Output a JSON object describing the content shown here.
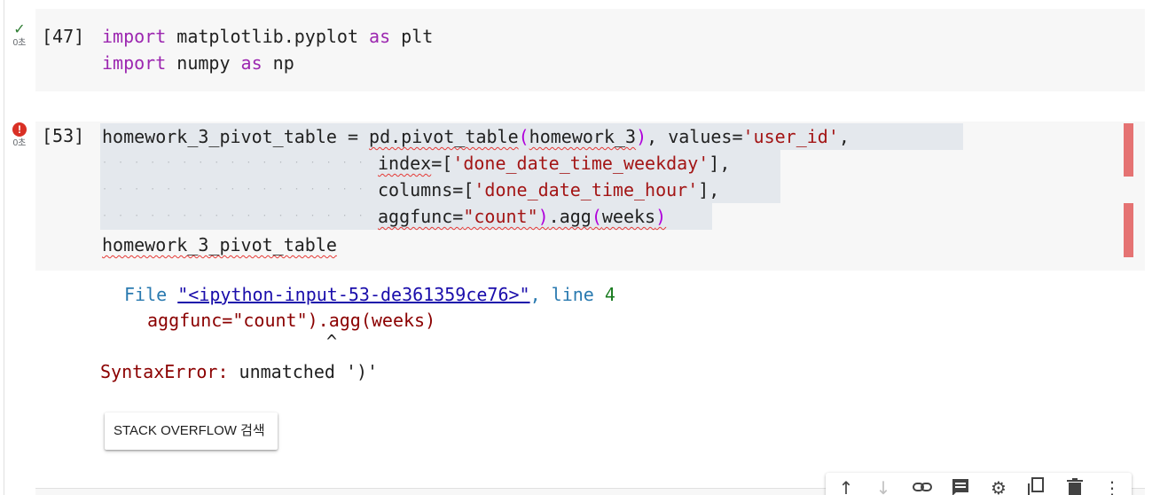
{
  "cells": [
    {
      "exec_count": "[47]",
      "status": "success",
      "elapsed": "0초",
      "code": {
        "l1_kw1": "import",
        "l1_mod": " matplotlib.pyplot ",
        "l1_kw2": "as",
        "l1_alias": " plt",
        "l2_kw1": "import",
        "l2_mod": " numpy ",
        "l2_kw2": "as",
        "l2_alias": " np"
      }
    },
    {
      "exec_count": "[53]",
      "status": "error",
      "elapsed": "0초",
      "code": {
        "l1_var": "homework_3_pivot_table",
        "l1_eq": " = ",
        "l1_func": "pd.pivot_table",
        "l1_open": "(",
        "l1_arg": "homework_3",
        "l1_close": ")",
        "l1_rest": ", values=",
        "l1_str": "'user_id'",
        "l1_end": ",",
        "l2_kw": "index",
        "l2_eq": "=[",
        "l2_str": "'done_date_time_weekday'",
        "l2_end": "],",
        "l3_kw": "columns",
        "l3_eq": "=[",
        "l3_str": "'done_date_time_hour'",
        "l3_end": "],",
        "l4_kw": "aggfunc=",
        "l4_str": "\"count\"",
        "l4_close": ")",
        "l4_mid": ".agg",
        "l4_open": "(",
        "l4_arg": "weeks",
        "l4_close2": ")",
        "l5": "homework_3_pivot_table"
      },
      "traceback": {
        "file_label": "File ",
        "file_link": "\"<ipython-input-53-de361359ce76>\"",
        "line_label": ", line ",
        "line_no": "4",
        "source": "aggfunc=\"count\").agg(weeks)",
        "caret": "^",
        "error_type": "SyntaxError:",
        "error_msg": " unmatched ')'"
      },
      "search_button": "STACK OVERFLOW 검색"
    }
  ],
  "toolbar": {
    "icons": [
      "arrow-up-icon",
      "arrow-down-icon",
      "link-icon",
      "comment-icon",
      "gear-icon",
      "mirror-cell-icon",
      "trash-icon",
      "more-vert-icon"
    ]
  },
  "colors": {
    "keyword": "#9c27b0",
    "string": "#a31515",
    "error_marker": "#e57373",
    "cell_bg": "#f7f7f7"
  }
}
